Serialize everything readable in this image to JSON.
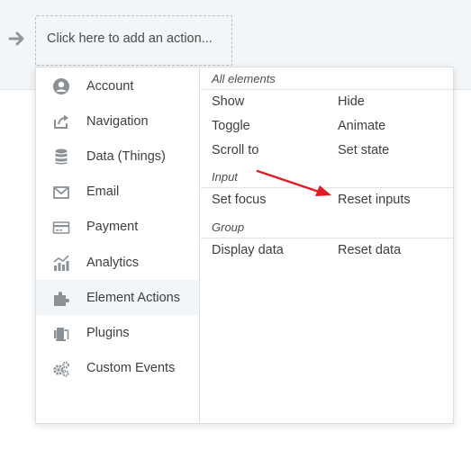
{
  "workflow": {
    "add_action_label": "Click here to add an action..."
  },
  "categories": [
    {
      "label": "Account",
      "icon": "account-icon"
    },
    {
      "label": "Navigation",
      "icon": "navigation-icon"
    },
    {
      "label": "Data (Things)",
      "icon": "database-icon"
    },
    {
      "label": "Email",
      "icon": "email-icon"
    },
    {
      "label": "Payment",
      "icon": "credit-card-icon"
    },
    {
      "label": "Analytics",
      "icon": "analytics-icon"
    },
    {
      "label": "Element Actions",
      "icon": "puzzle-icon",
      "active": true
    },
    {
      "label": "Plugins",
      "icon": "plugin-icon"
    },
    {
      "label": "Custom Events",
      "icon": "gears-icon"
    }
  ],
  "groups": {
    "all_elements": {
      "title": "All elements",
      "actions": [
        "Show",
        "Hide",
        "Toggle",
        "Animate",
        "Scroll to",
        "Set state"
      ]
    },
    "input": {
      "title": "Input",
      "actions": [
        "Set focus",
        "Reset inputs"
      ]
    },
    "group": {
      "title": "Group",
      "actions": [
        "Display data",
        "Reset data"
      ]
    }
  },
  "colors": {
    "annotation_arrow": "#e31b23",
    "icon": "#8a9197",
    "active_row": "#f3f6f8"
  }
}
